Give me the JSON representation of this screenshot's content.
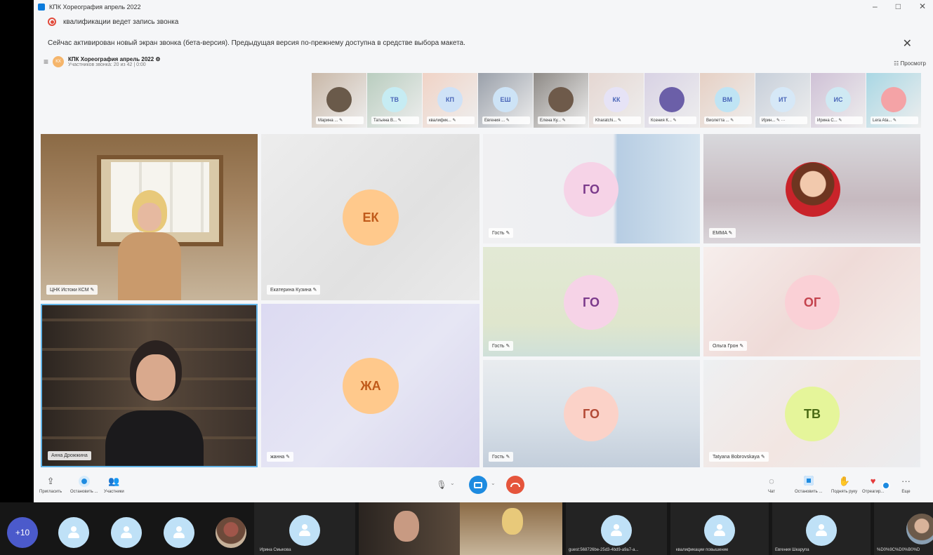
{
  "window": {
    "title": "КПК Хореография апрель 2022",
    "minimize": "–",
    "maximize": "□",
    "close": "✕"
  },
  "recording": {
    "text": "квалификации ведет запись звонка"
  },
  "notice": {
    "text": "Сейчас активирован новый экран звонка (бета-версия). Предыдущая версия по-прежнему доступна в средстве выбора макета.",
    "close": "✕"
  },
  "call": {
    "avatar": "КХ",
    "title": "КПК Хореография апрель 2022 ⚙",
    "subtitle": "Участников звонка: 20 из 42 | 0:00",
    "view_label": "☷ Просмотр"
  },
  "thumbnails": [
    {
      "initials": "",
      "label": "Марина ... ✎",
      "bg": "#c9b8a8",
      "av": "#6a5a4a"
    },
    {
      "initials": "ТВ",
      "label": "Татьяна В... ✎",
      "bg": "#b9cdbf",
      "av": "#c6ecf3"
    },
    {
      "initials": "КП",
      "label": "квалифик... ✎",
      "bg": "#f0d3c6",
      "av": "#cfe2f7"
    },
    {
      "initials": "ЕШ",
      "label": "Евгения ... ✎",
      "bg": "#9aa0aa",
      "av": "#cde3f6"
    },
    {
      "initials": "",
      "label": "Елена Ку... ✎",
      "bg": "#8e8a86",
      "av": "#6e5a4a"
    },
    {
      "initials": "КК",
      "label": "Kharatchi... ✎",
      "bg": "#e5d7d2",
      "av": "#e6e3f6"
    },
    {
      "initials": "",
      "label": "Ксения К... ✎",
      "bg": "#d8d2e4",
      "av": "#6b5fa8"
    },
    {
      "initials": "ВМ",
      "label": "Виолетта ... ✎",
      "bg": "#e6d0c4",
      "av": "#bfe4f4"
    },
    {
      "initials": "ИТ",
      "label": "Ирин... ✎ ···",
      "bg": "#c7cfda",
      "av": "#d6e8f7"
    },
    {
      "initials": "ИС",
      "label": "Ирина С... ✎",
      "bg": "#cfc1d6",
      "av": "#cfe9f3"
    },
    {
      "initials": "",
      "label": "Lera Ata... ✎",
      "bg": "#a9d7e4",
      "av": "#f4a3a6"
    }
  ],
  "tiles": {
    "t1": {
      "name": "ЦНК Истоки КСМ ✎"
    },
    "t2": {
      "initials": "ЕК",
      "name": "Екатерина Кузина ✎"
    },
    "t3": {
      "initials": "ГО",
      "name": "Гость ✎"
    },
    "t4": {
      "name": "EMMA ✎"
    },
    "t5": {
      "name": "Анна Дрожжина"
    },
    "t6": {
      "initials": "ГО",
      "name": "Гость ✎"
    },
    "t7": {
      "initials": "ОГ",
      "name": "Ольга Грон ✎"
    },
    "t8": {
      "initials": "ЖА",
      "name": "жанна ✎"
    },
    "t9": {
      "initials": "ГО",
      "name": "Гость ✎"
    },
    "t10": {
      "initials": "ТВ",
      "name": "Tatyana Bobrovskaya ✎"
    }
  },
  "controls": {
    "invite": "Пригласить",
    "stop": "Остановить ...",
    "participants": "Участники",
    "chat": "Чат",
    "stop2": "Остановить ...",
    "raise_hand": "Поднять руку",
    "react": "Отреагир...",
    "more": "Еще",
    "more_icon": "···"
  },
  "bottom": {
    "more_count": "+10",
    "names": [
      "Ирина Смыкова",
      "guest:568726be-25d3-4bd9-a9a7-a...",
      "квалификации повышение",
      "Евгения Шкарупа",
      "%D0%9C%D0%B0%D"
    ]
  },
  "colors": {
    "accent": "#0b7bdc",
    "end_call": "#e5553c"
  }
}
